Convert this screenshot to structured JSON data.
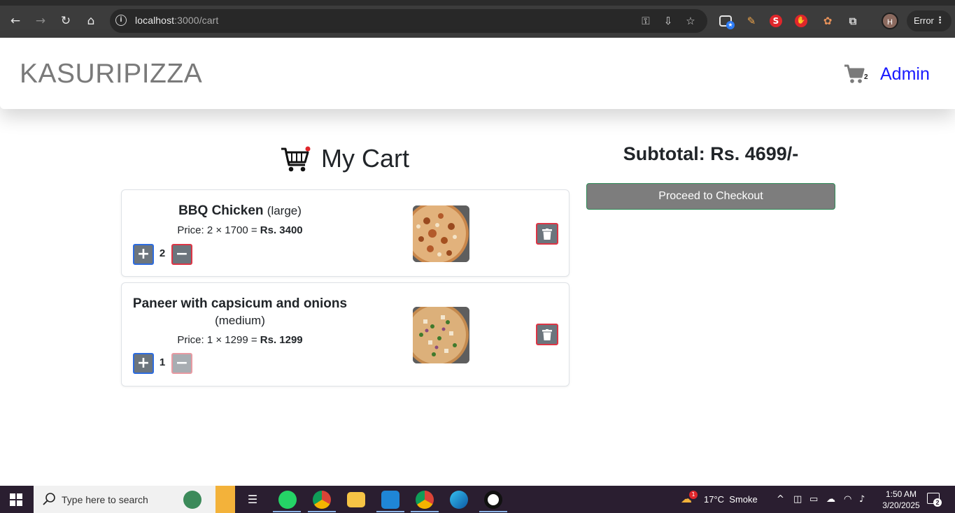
{
  "browser": {
    "url_host": "localhost",
    "url_path": ":3000/cart",
    "profile_initial": "H",
    "error_label": "Error"
  },
  "navbar": {
    "brand": "KASURIPIZZA",
    "cart_count": "2",
    "admin_label": "Admin"
  },
  "cart": {
    "title": "My Cart",
    "items": [
      {
        "name": "BBQ Chicken",
        "size": "(large)",
        "price_prefix": "Price: 2 × 1700 = ",
        "price_total": "Rs. 3400",
        "quantity": "2"
      },
      {
        "name": "Paneer with capsicum and onions",
        "size": "(medium)",
        "price_prefix": "Price: 1 × 1299 = ",
        "price_total": "Rs. 1299",
        "quantity": "1"
      }
    ]
  },
  "summary": {
    "subtotal": "Subtotal: Rs. 4699/-",
    "checkout_label": "Proceed to Checkout"
  },
  "taskbar": {
    "search_placeholder": "Type here to search",
    "weather": "17°C  Smoke",
    "weather_badge": "1",
    "time": "1:50 AM",
    "date": "3/20/2025",
    "notification_count": "2"
  },
  "colors": {
    "brand_gray": "#7a7a7a",
    "admin_blue": "#1a1aff",
    "button_gray": "#6c757d",
    "danger_red": "#dc3545",
    "primary_blue": "#2d6cdf",
    "checkout_border": "#2e8b57"
  }
}
